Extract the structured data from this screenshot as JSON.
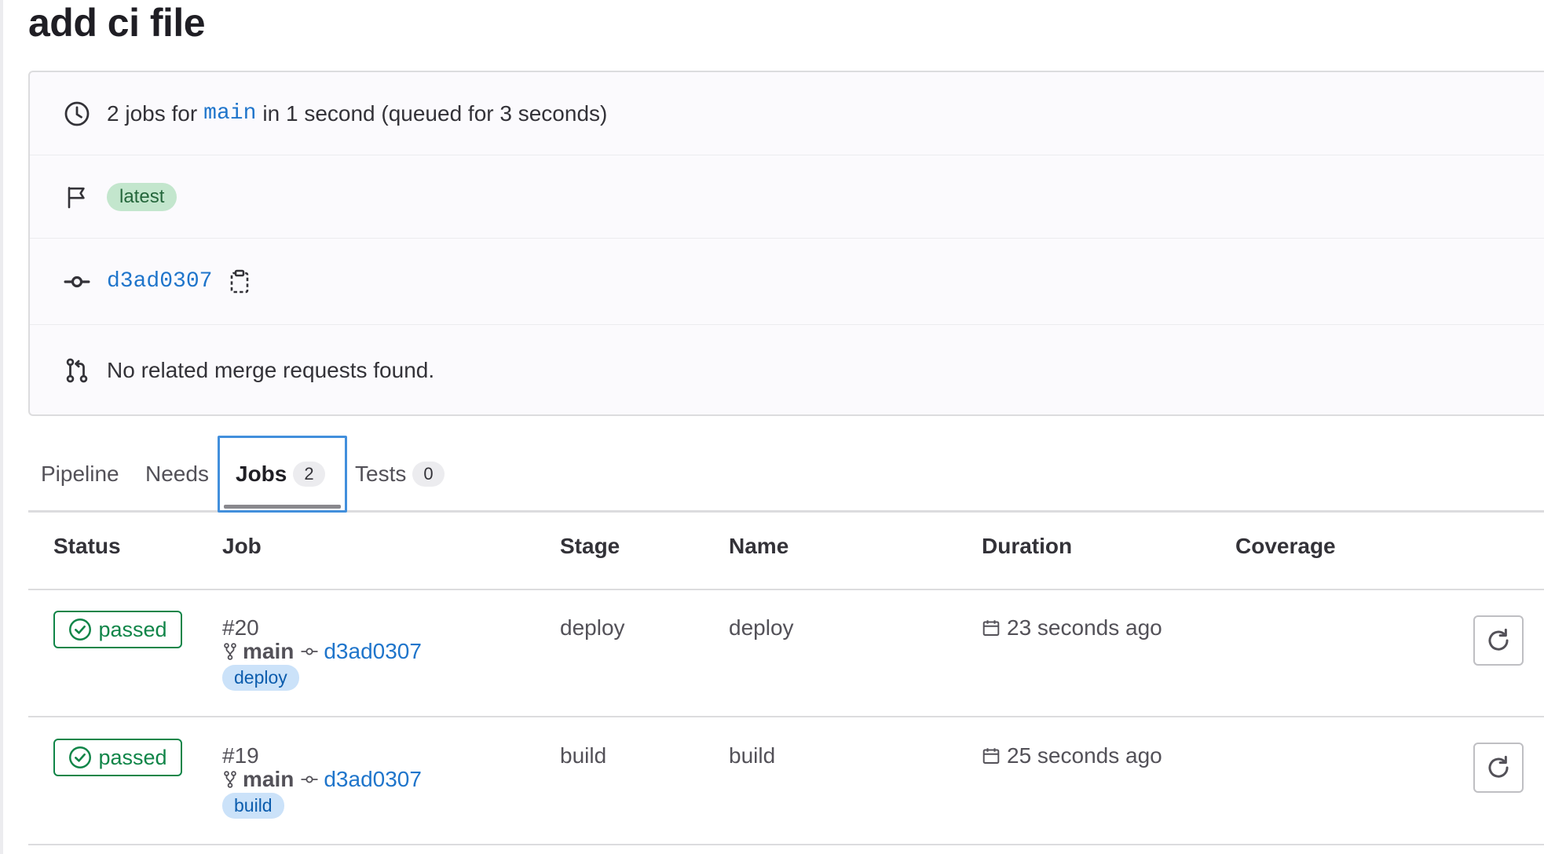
{
  "page": {
    "title": "add ci file"
  },
  "info": {
    "summary_prefix": "2 jobs for",
    "branch": "main",
    "summary_suffix": "in 1 second (queued for 3 seconds)",
    "latest_badge": "latest",
    "commit_sha": "d3ad0307",
    "merge_requests_text": "No related merge requests found."
  },
  "tabs": {
    "pipeline": "Pipeline",
    "needs": "Needs",
    "jobs": "Jobs",
    "jobs_count": "2",
    "tests": "Tests",
    "tests_count": "0",
    "active": "Jobs"
  },
  "table": {
    "headers": {
      "status": "Status",
      "job": "Job",
      "stage": "Stage",
      "name": "Name",
      "duration": "Duration",
      "coverage": "Coverage"
    },
    "rows": [
      {
        "status": "passed",
        "job_id": "#20",
        "branch": "main",
        "commit": "d3ad0307",
        "stage_pill": "deploy",
        "stage": "deploy",
        "name": "deploy",
        "duration": "23 seconds ago",
        "coverage": ""
      },
      {
        "status": "passed",
        "job_id": "#19",
        "branch": "main",
        "commit": "d3ad0307",
        "stage_pill": "build",
        "stage": "build",
        "name": "build",
        "duration": "25 seconds ago",
        "coverage": ""
      }
    ]
  },
  "icons": {
    "summary": "clock-icon",
    "latest": "flag-icon",
    "commit": "commit-icon",
    "merge_requests": "merge-request-icon",
    "copy": "copy-to-clipboard-icon",
    "status": "check-circle-icon",
    "branch": "branch-icon",
    "duration": "calendar-icon",
    "retry": "retry-icon"
  },
  "colors": {
    "link": "#1f75cb",
    "success": "#108548",
    "latest_bg": "#c3e6cd",
    "stage_bg": "#cbe2f9",
    "focus": "#428fdc"
  }
}
